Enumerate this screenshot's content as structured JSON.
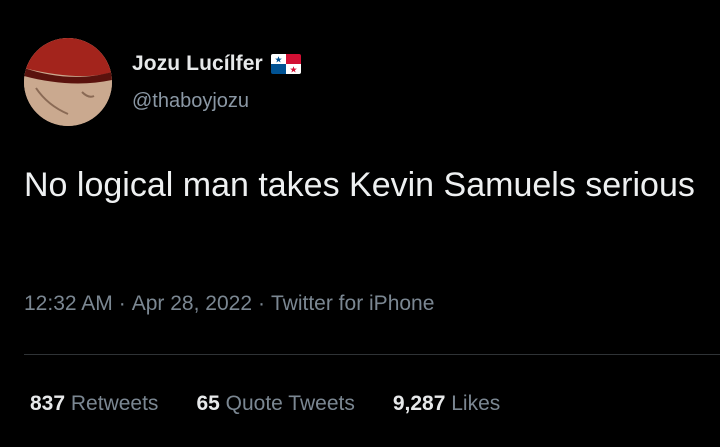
{
  "user": {
    "display_name": "Jozu Lucílfer",
    "handle": "@thaboyjozu",
    "flag_icon": "panama-flag-icon",
    "avatar_icon": "avatar-photo"
  },
  "tweet": {
    "text": "No logical man takes Kevin Samuels serious"
  },
  "meta": {
    "time": "12:32 AM",
    "separator": "·",
    "date": "Apr 28, 2022",
    "source": "Twitter for iPhone"
  },
  "stats": {
    "retweets_count": "837",
    "retweets_label": "Retweets",
    "quotes_count": "65",
    "quotes_label": "Quote Tweets",
    "likes_count": "9,287",
    "likes_label": "Likes"
  },
  "colors": {
    "background": "#000000",
    "primary_text": "#e7e9ea",
    "secondary_text": "#7b8792",
    "divider": "#2f3336",
    "flag_red": "#d21034",
    "flag_blue": "#005293"
  }
}
